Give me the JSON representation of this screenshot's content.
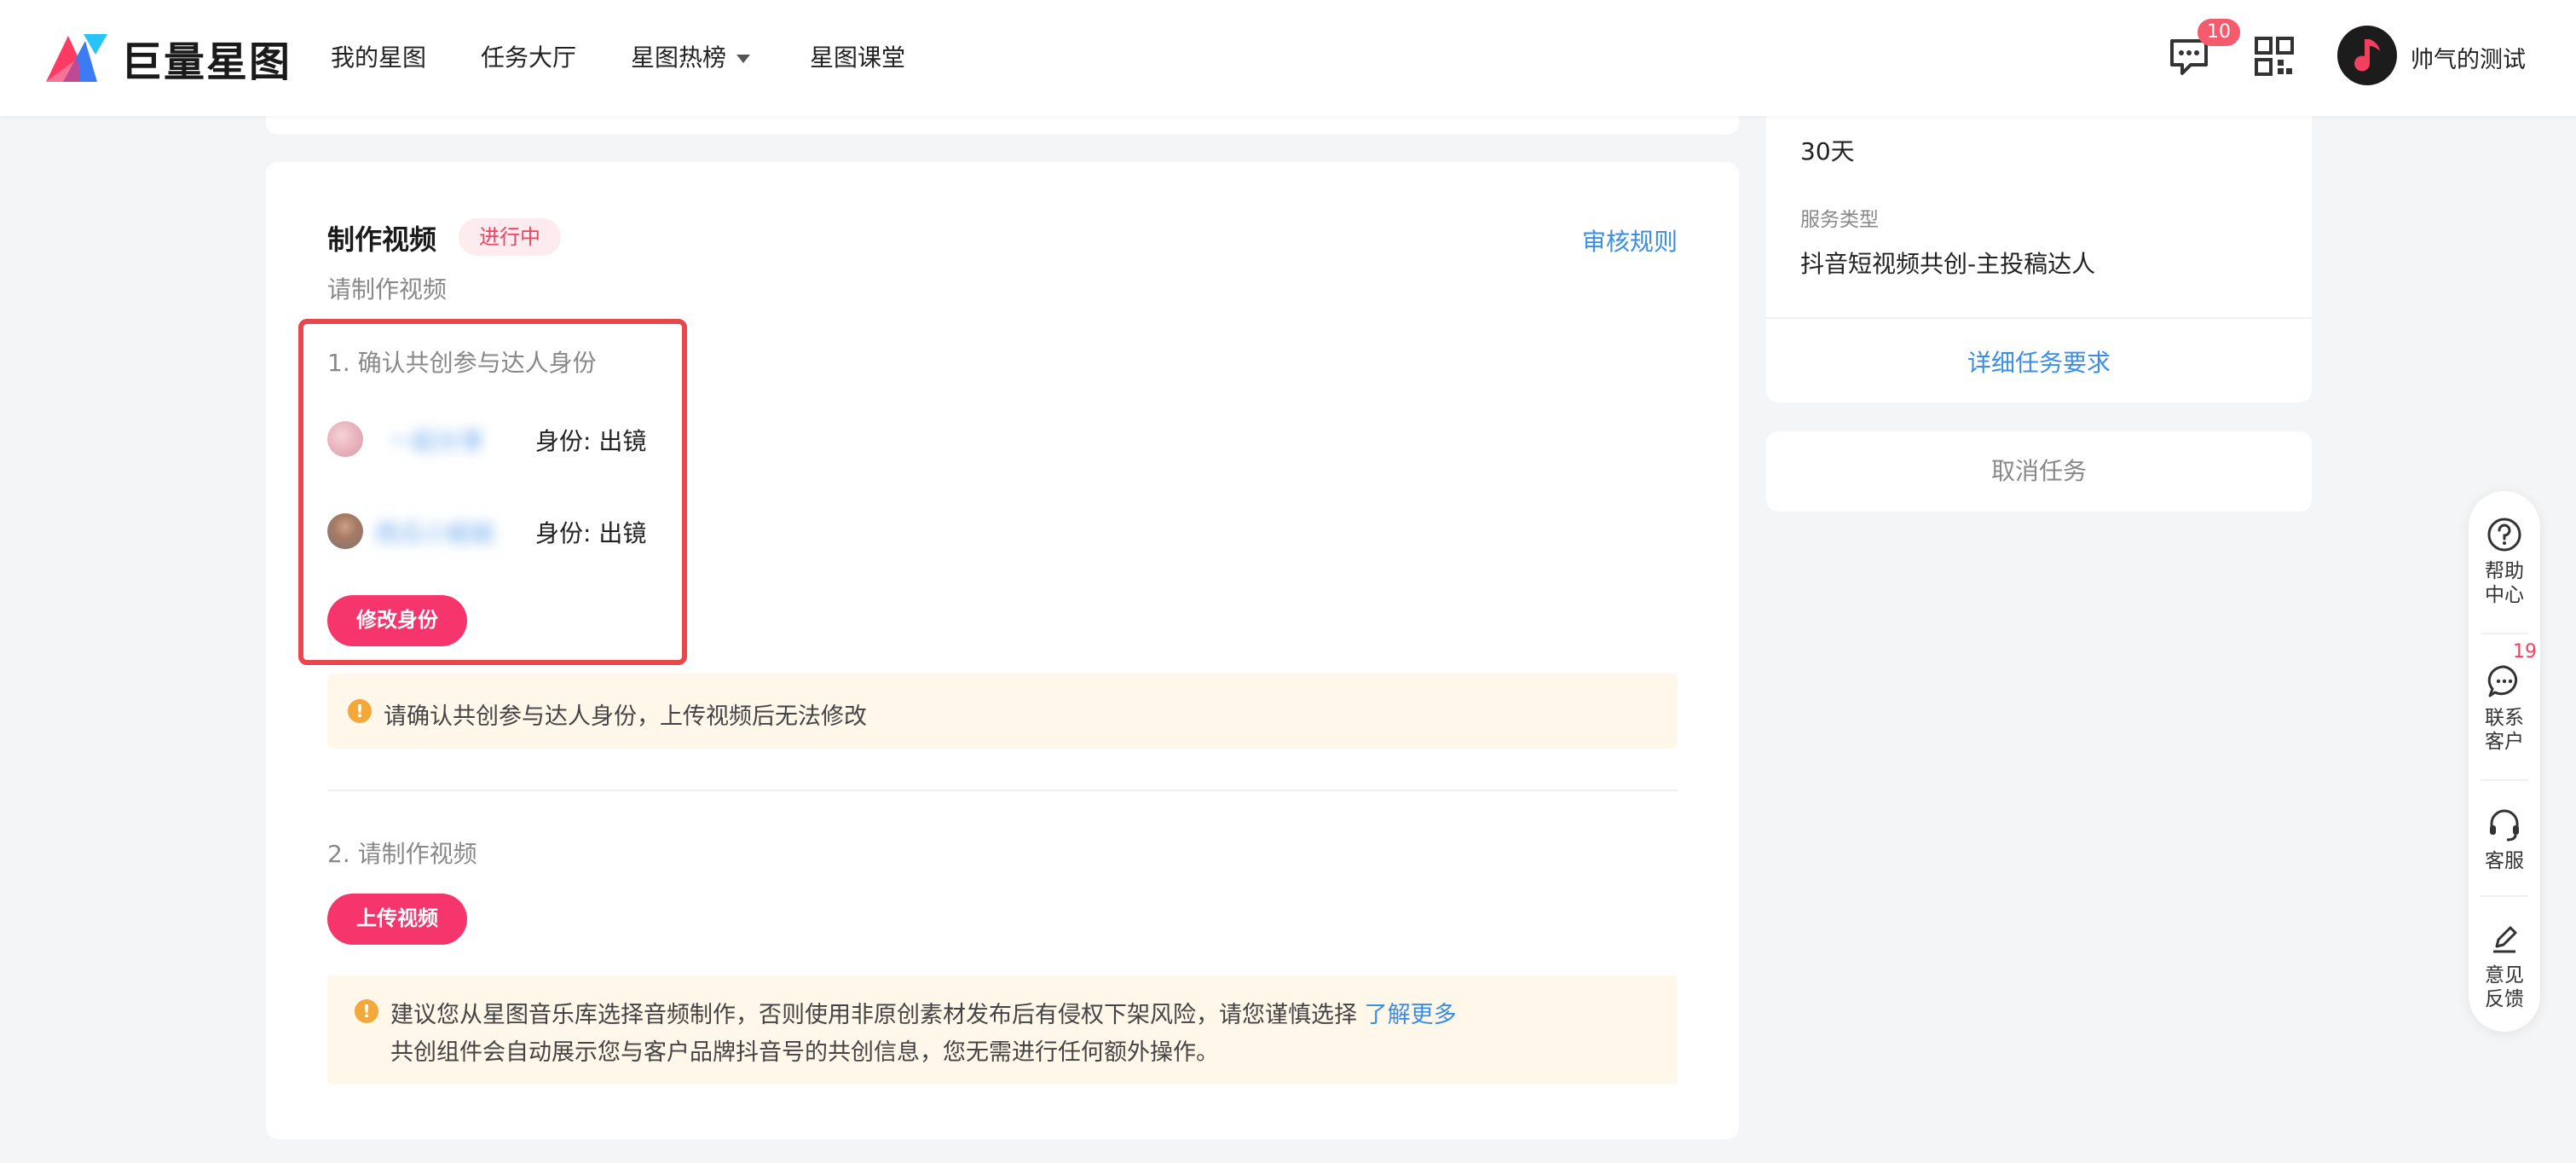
{
  "header": {
    "logo_text": "巨量星图",
    "nav": [
      {
        "label": "我的星图"
      },
      {
        "label": "任务大厅"
      },
      {
        "label": "星图热榜"
      },
      {
        "label": "星图课堂"
      }
    ],
    "message_badge": "10",
    "user_name": "帅气的测试"
  },
  "task": {
    "title": "制作视频",
    "status": "进行中",
    "rules_link": "审核规则",
    "subtitle": "请制作视频",
    "step1": {
      "title": "1. 确认共创参与达人身份",
      "creators": [
        {
          "name": "一起分享",
          "identity": "身份: 出镜"
        },
        {
          "name": "西瓜小姐姐",
          "identity": "身份: 出镜"
        }
      ],
      "edit_button": "修改身份",
      "notice": "请确认共创参与达人身份，上传视频后无法修改"
    },
    "step2": {
      "title": "2. 请制作视频",
      "upload_button": "上传视频",
      "notice_line1": "建议您从星图音乐库选择音频制作，否则使用非原创素材发布后有侵权下架风险，请您谨慎选择",
      "notice_link": "了解更多",
      "notice_line2": "共创组件会自动展示您与客户品牌抖音号的共创信息，您无需进行任何额外操作。"
    }
  },
  "sidebar_info": {
    "duration_value": "30天",
    "service_label": "服务类型",
    "service_value": "抖音短视频共创-主投稿达人",
    "detail_link": "详细任务要求",
    "cancel_label": "取消任务"
  },
  "float_bar": {
    "items": [
      {
        "label": "帮助\n中心",
        "icon": "question-icon"
      },
      {
        "label": "联系\n客户",
        "icon": "chat-icon"
      },
      {
        "label": "客服",
        "icon": "headset-icon"
      },
      {
        "label": "意见\n反馈",
        "icon": "edit-icon"
      }
    ],
    "contact_badge": "19"
  },
  "colors": {
    "accent_pink": "#f5356b",
    "link_blue": "#3a8ee6",
    "highlight_red": "#e8484b",
    "notice_bg": "#fff7ea"
  }
}
